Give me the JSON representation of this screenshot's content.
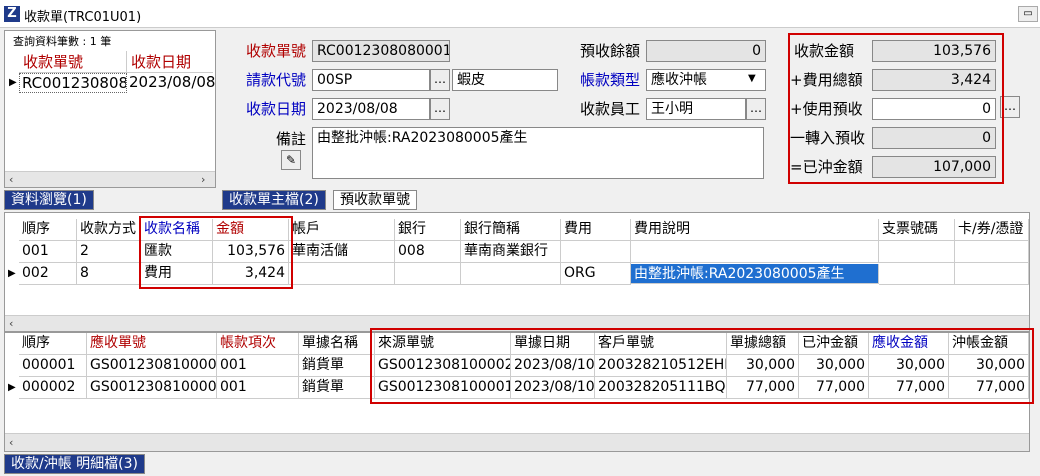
{
  "window": {
    "title": "收款單(TRC01U01)",
    "logo": "Z",
    "control_icon": "restore-icon"
  },
  "browse": {
    "count_label": "查詢資料筆數 : 1 筆",
    "columns": [
      "收款單號",
      "收款日期"
    ],
    "rows": [
      [
        "RC0012308080001",
        "2023/08/08"
      ]
    ],
    "tab": "資料瀏覽(1)"
  },
  "header": {
    "receipt_no_label": "收款單號",
    "receipt_no": "RC0012308080001",
    "customer_label": "請款代號",
    "customer_code": "00SP",
    "customer_name": "蝦皮",
    "date_label": "收款日期",
    "date": "2023/08/08",
    "remark_label": "備註",
    "remark": "由整批沖帳:RA2023080005產生",
    "prepay_balance_label": "預收餘額",
    "prepay_balance": "0",
    "account_type_label": "帳款類型",
    "account_type": "應收沖帳",
    "staff_label": "收款員工",
    "staff": "王小明"
  },
  "totals": {
    "amount_label": "收款金額",
    "amount": "103,576",
    "fee_label": "+費用總額",
    "fee": "3,424",
    "use_prepay_label": "+使用預收",
    "use_prepay": "0",
    "transfer_label": "一轉入預收",
    "transfer": "0",
    "settled_label": "=已沖金額",
    "settled": "107,000"
  },
  "tabs": [
    "收款單主檔(2)",
    "預收款單號"
  ],
  "detail": {
    "columns": [
      "順序",
      "收款方式",
      "收款名稱",
      "金額",
      "帳戶",
      "銀行",
      "銀行簡稱",
      "費用",
      "費用說明",
      "支票號碼",
      "卡/券/憑證"
    ],
    "rows": [
      [
        "001",
        "2",
        "匯款",
        "103,576",
        "華南活儲",
        "008",
        "華南商業銀行",
        "",
        "",
        "",
        ""
      ],
      [
        "002",
        "8",
        "費用",
        "3,424",
        "",
        "",
        "",
        "ORG",
        "由整批沖帳:RA2023080005產生",
        "",
        ""
      ]
    ]
  },
  "settle": {
    "columns": [
      "順序",
      "應收單號",
      "帳款項次",
      "單據名稱",
      "來源單號",
      "單據日期",
      "客戶單號",
      "單據總額",
      "已沖金額",
      "應收金額",
      "沖帳金額"
    ],
    "rows": [
      [
        "000001",
        "GS0012308100002",
        "001",
        "銷貨單",
        "GS0012308100002",
        "2023/08/10",
        "200328210512EHP",
        "30,000",
        "30,000",
        "30,000",
        "30,000"
      ],
      [
        "000002",
        "GS0012308100001",
        "001",
        "銷貨單",
        "GS0012308100001",
        "2023/08/10",
        "200328205111BQS",
        "77,000",
        "77,000",
        "77,000",
        "77,000"
      ]
    ],
    "tab": "收款/沖帳 明細檔(3)"
  },
  "colors": {
    "accent": "#1f3a8a",
    "label_red": "#b00000",
    "label_blue": "#0000c0",
    "highlight": "#d00000"
  }
}
